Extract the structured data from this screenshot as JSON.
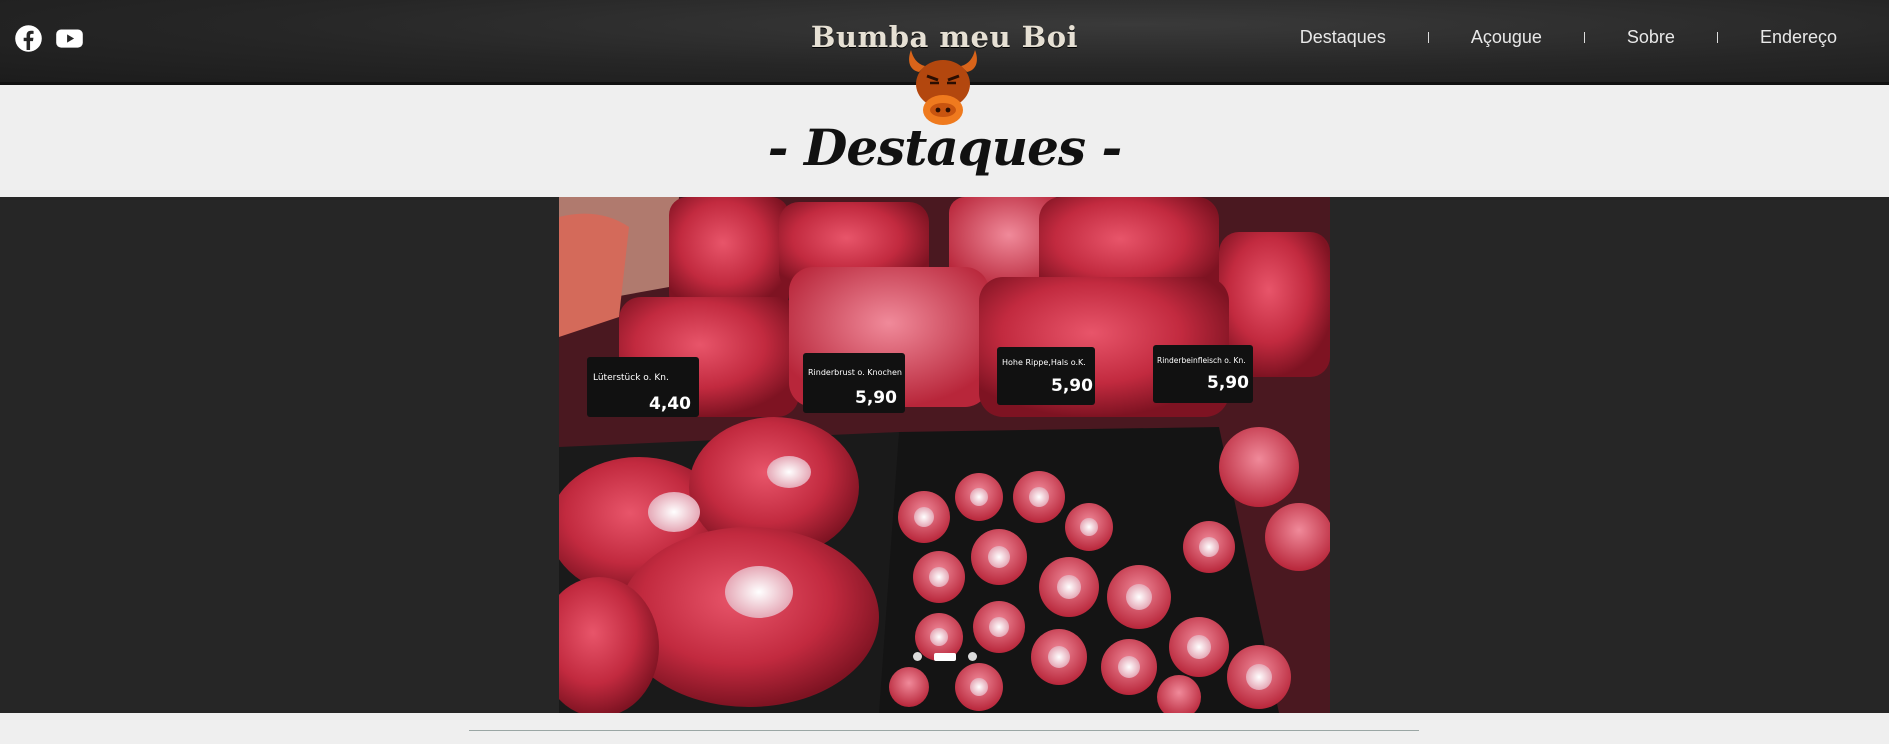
{
  "header": {
    "brand": "Bumba meu Boi",
    "social": [
      "facebook-icon",
      "youtube-icon"
    ],
    "nav": [
      "Destaques",
      "Açougue",
      "Sobre",
      "Endereço"
    ]
  },
  "section": {
    "title": "- Destaques -"
  },
  "carousel": {
    "slides": 3,
    "active_index": 1,
    "price_tags": [
      {
        "name": "Lüterstück o. Kn.",
        "price": "4,40"
      },
      {
        "name": "Rinderbrust o. Knochen",
        "price": "5,90"
      },
      {
        "name": "Hohe Rippe,Hals o.K.",
        "price": "5,90"
      },
      {
        "name": "Rinderbeinfleisch o. Kn.",
        "price": "5,90"
      }
    ]
  },
  "colors": {
    "header_bg": "#262626",
    "band_bg": "#efefef",
    "slider_bg": "#262626",
    "bull": "#b3470e"
  }
}
